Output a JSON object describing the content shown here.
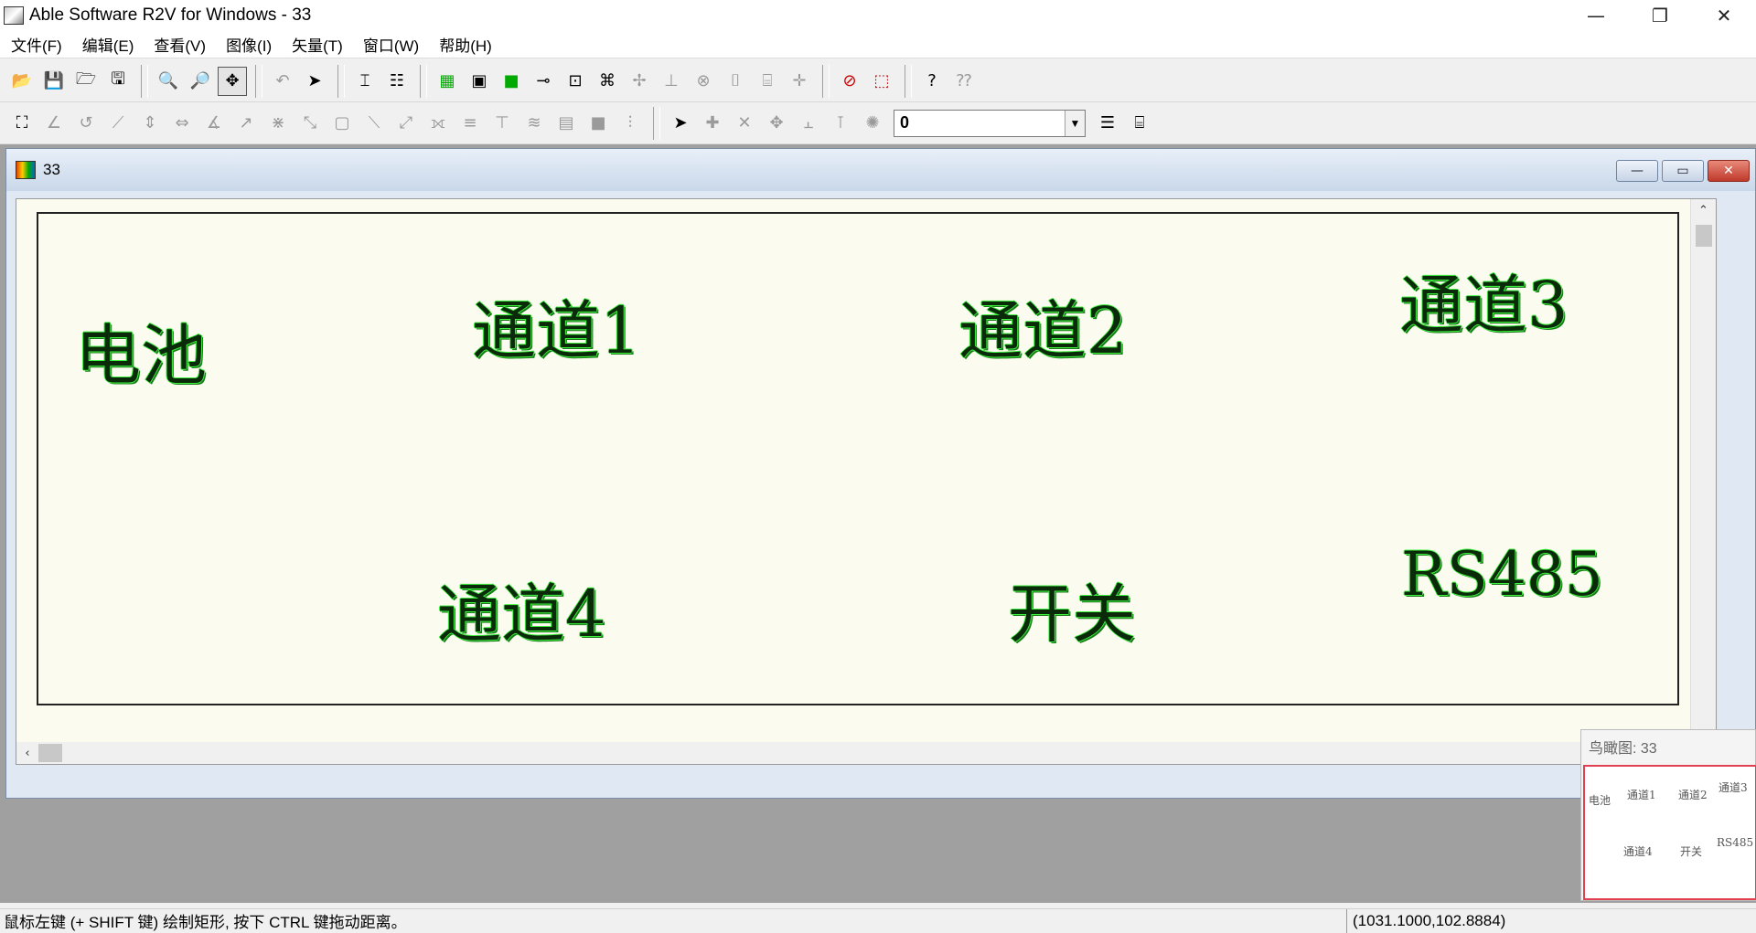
{
  "window": {
    "title": "Able Software R2V for Windows - 33",
    "minimize": "—",
    "restore": "❐",
    "close": "✕"
  },
  "menu": [
    "文件(F)",
    "编辑(E)",
    "查看(V)",
    "图像(I)",
    "矢量(T)",
    "窗口(W)",
    "帮助(H)"
  ],
  "toolbar1": {
    "icons": [
      "open-icon",
      "save-icon",
      "open-project-icon",
      "save-project-icon",
      "zoom-in-icon",
      "zoom-out-icon",
      "pan-tool-icon",
      "undo-icon",
      "select-arrow-icon",
      "trace-icon",
      "auto-trace-icon",
      "color-map-icon",
      "frame-icon",
      "green-fill-icon",
      "node-link-icon",
      "node-icon",
      "network-icon",
      "add-point-icon",
      "point-id-icon",
      "stop-icon",
      "ocr-abc-icon",
      "abl-icon",
      "crosshair-icon",
      "select-cancel-icon",
      "select-box-icon",
      "help-icon",
      "context-help-icon"
    ]
  },
  "toolbar2": {
    "layer_value": "0",
    "dropdown_arrow": "▼"
  },
  "child_window": {
    "title": "33",
    "minimize": "—",
    "restore": "▭",
    "close": "✕"
  },
  "canvas": {
    "labels": [
      {
        "text": "电池"
      },
      {
        "text": "通道1"
      },
      {
        "text": "通道2"
      },
      {
        "text": "通道3"
      },
      {
        "text": "通道4"
      },
      {
        "text": "开关"
      },
      {
        "text": "RS485"
      }
    ],
    "scroll_up": "⌃",
    "scroll_left": "‹"
  },
  "birdseye": {
    "title": "鸟瞰图: 33",
    "minis": [
      "电池",
      "通道1",
      "通道2",
      "通道3",
      "通道4",
      "开关",
      "RS485"
    ]
  },
  "status": {
    "message": "鼠标左键 (+ SHIFT 键) 绘制矩形, 按下 CTRL 键拖动距离。",
    "coords": "(1031.1000,102.8884)"
  }
}
